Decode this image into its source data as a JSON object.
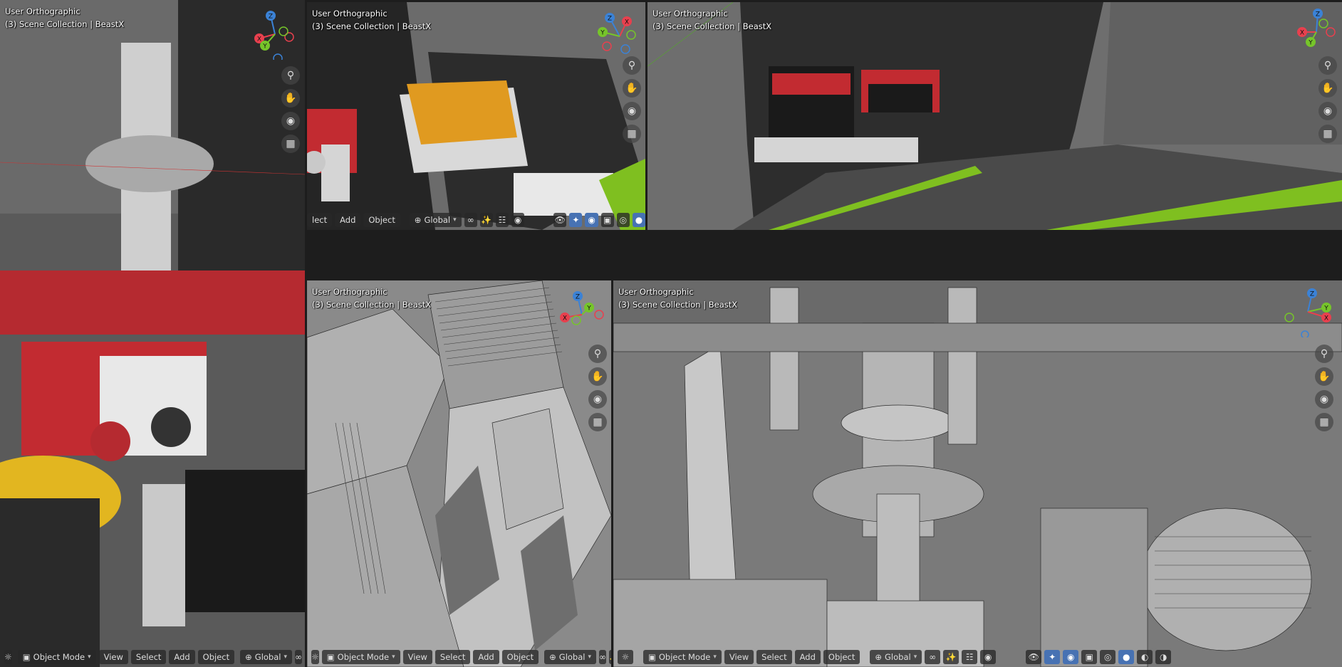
{
  "viewports": [
    {
      "view": "User Orthographic",
      "collection": "(3) Scene Collection | BeastX"
    },
    {
      "view": "User Orthographic",
      "collection": "(3) Scene Collection | BeastX"
    },
    {
      "view": "User Orthographic",
      "collection": "(3) Scene Collection | BeastX"
    },
    {
      "view": "User Orthographic",
      "collection": "(3) Scene Collection | BeastX"
    },
    {
      "view": "User Orthographic",
      "collection": "(3) Scene Collection | BeastX"
    }
  ],
  "axes": {
    "x": "X",
    "y": "Y",
    "z": "Z"
  },
  "toolbar": {
    "mode": "Object Mode",
    "view": "View",
    "select": "Select",
    "select_partial": "lect",
    "add": "Add",
    "object": "Object",
    "transform_orientation": "Global"
  },
  "colors": {
    "axis_x": "#e8404e",
    "axis_y": "#76c52a",
    "axis_z": "#3b82d6",
    "active": "#4772b3"
  },
  "icons": {
    "zoom": "zoom-icon",
    "pan": "hand-pan-icon",
    "camera": "camera-icon",
    "grid": "grid-icon"
  }
}
